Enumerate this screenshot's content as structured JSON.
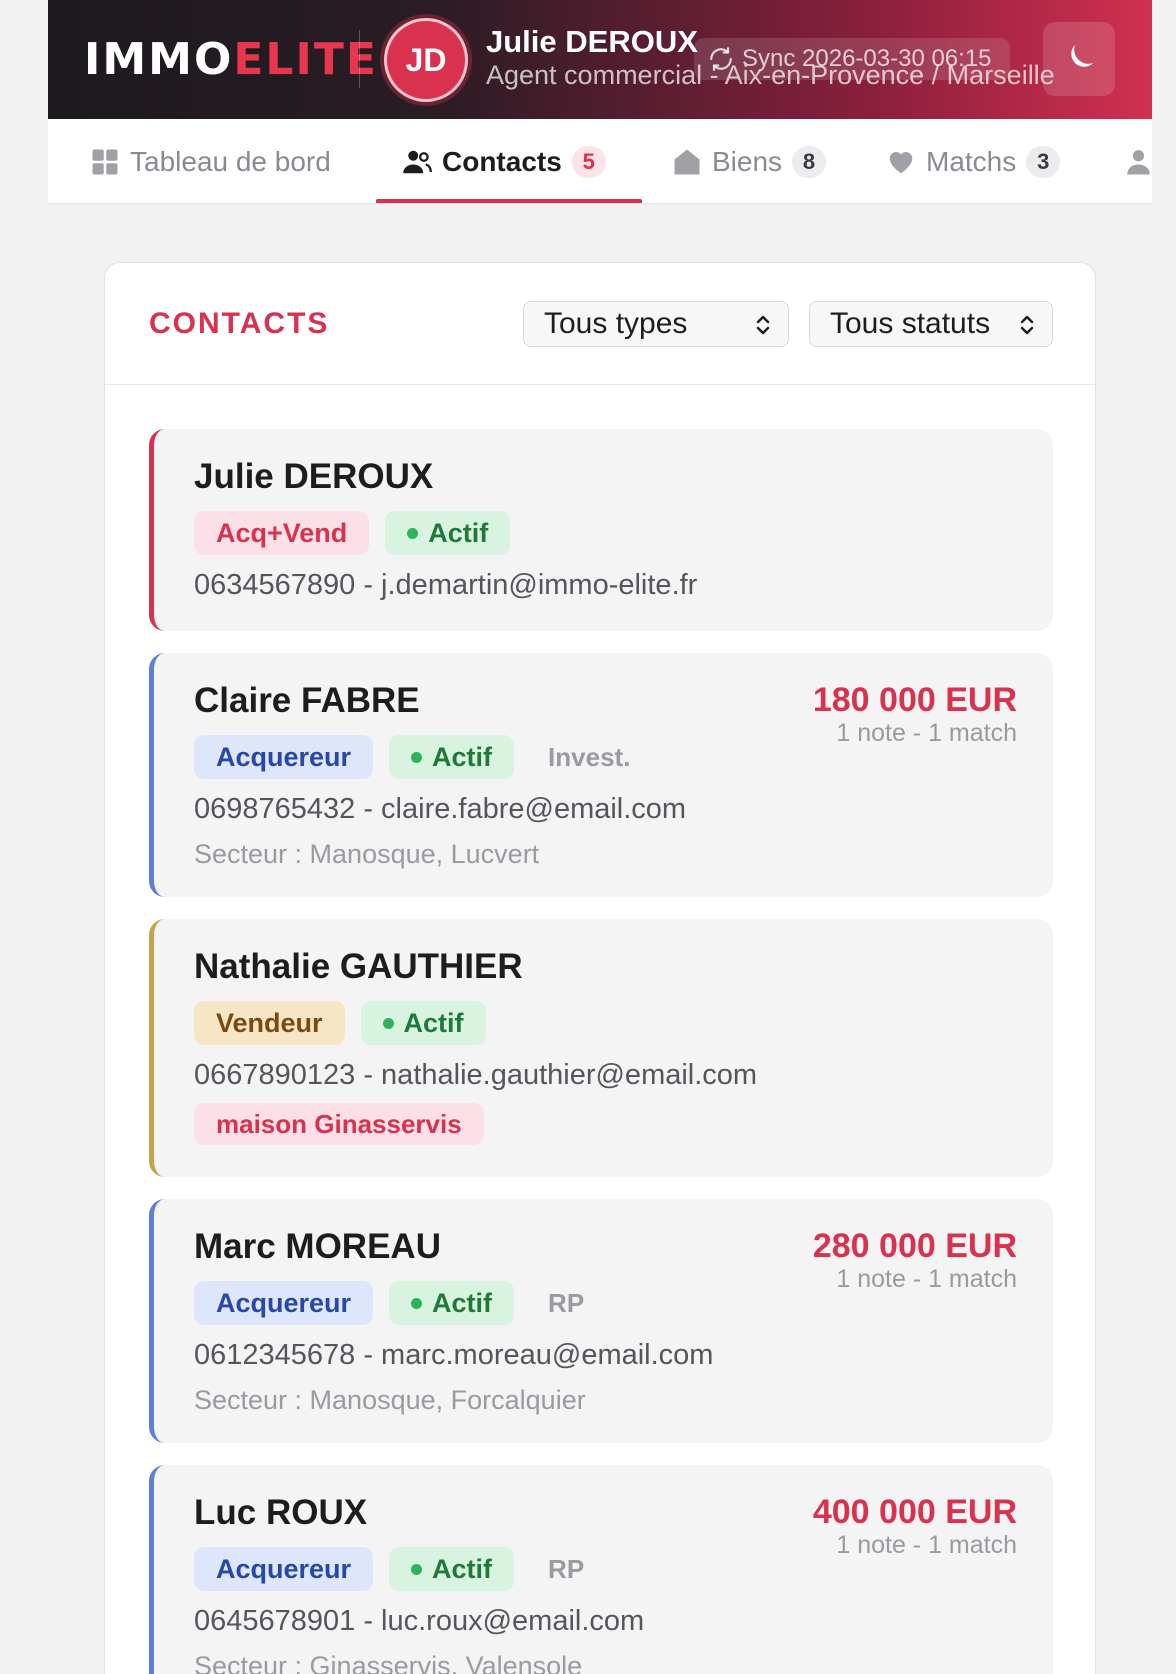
{
  "header": {
    "logo_primary": "IMMO",
    "logo_accent": "ELITE",
    "avatar_initials": "JD",
    "user_name": "Julie DEROUX",
    "user_role": "Agent commercial - Aix-en-Provence / Marseille",
    "sync_label": "Sync 2026-03-30 06:15",
    "sync_icon": "refresh-icon",
    "theme_icon": "moon-icon"
  },
  "nav": {
    "tabs": [
      {
        "label": "Tableau de bord",
        "icon": "dashboard-icon",
        "count": ""
      },
      {
        "label": "Contacts",
        "icon": "users-icon",
        "count": "5",
        "active": true
      },
      {
        "label": "Biens",
        "icon": "house-icon",
        "count": "8"
      },
      {
        "label": "Matchs",
        "icon": "heart-icon",
        "count": "3"
      },
      {
        "label": "",
        "icon": "user-icon",
        "count": ""
      }
    ]
  },
  "panel": {
    "title": "CONTACTS",
    "type_filter": "Tous types",
    "status_filter": "Tous statuts"
  },
  "contacts": [
    {
      "name": "Julie DEROUX",
      "type": "Acq+Vend",
      "status": "Actif",
      "tag": "",
      "contact": "0634567890 - j.demartin@immo-elite.fr",
      "sector": "",
      "chip": "",
      "price": "",
      "meta": ""
    },
    {
      "name": "Claire FABRE",
      "type": "Acquereur",
      "status": "Actif",
      "tag": "Invest.",
      "contact": "0698765432 - claire.fabre@email.com",
      "sector": "Secteur : Manosque, Lucvert",
      "chip": "",
      "price": "180 000 EUR",
      "meta": "1 note - 1 match"
    },
    {
      "name": "Nathalie GAUTHIER",
      "type": "Vendeur",
      "status": "Actif",
      "tag": "",
      "contact": "0667890123 - nathalie.gauthier@email.com",
      "sector": "",
      "chip": "maison Ginasservis",
      "price": "",
      "meta": ""
    },
    {
      "name": "Marc MOREAU",
      "type": "Acquereur",
      "status": "Actif",
      "tag": "RP",
      "contact": "0612345678 - marc.moreau@email.com",
      "sector": "Secteur : Manosque, Forcalquier",
      "chip": "",
      "price": "280 000 EUR",
      "meta": "1 note - 1 match"
    },
    {
      "name": "Luc ROUX",
      "type": "Acquereur",
      "status": "Actif",
      "tag": "RP",
      "contact": "0645678901 - luc.roux@email.com",
      "sector": "Secteur : Ginasservis, Valensole",
      "chip": "",
      "price": "400 000 EUR",
      "meta": "1 note - 1 match"
    }
  ],
  "colors": {
    "accent": "#d9324f",
    "acquereur": "#5b80d6",
    "vendeur": "#c9a14a",
    "actif": "#2fb35a"
  }
}
